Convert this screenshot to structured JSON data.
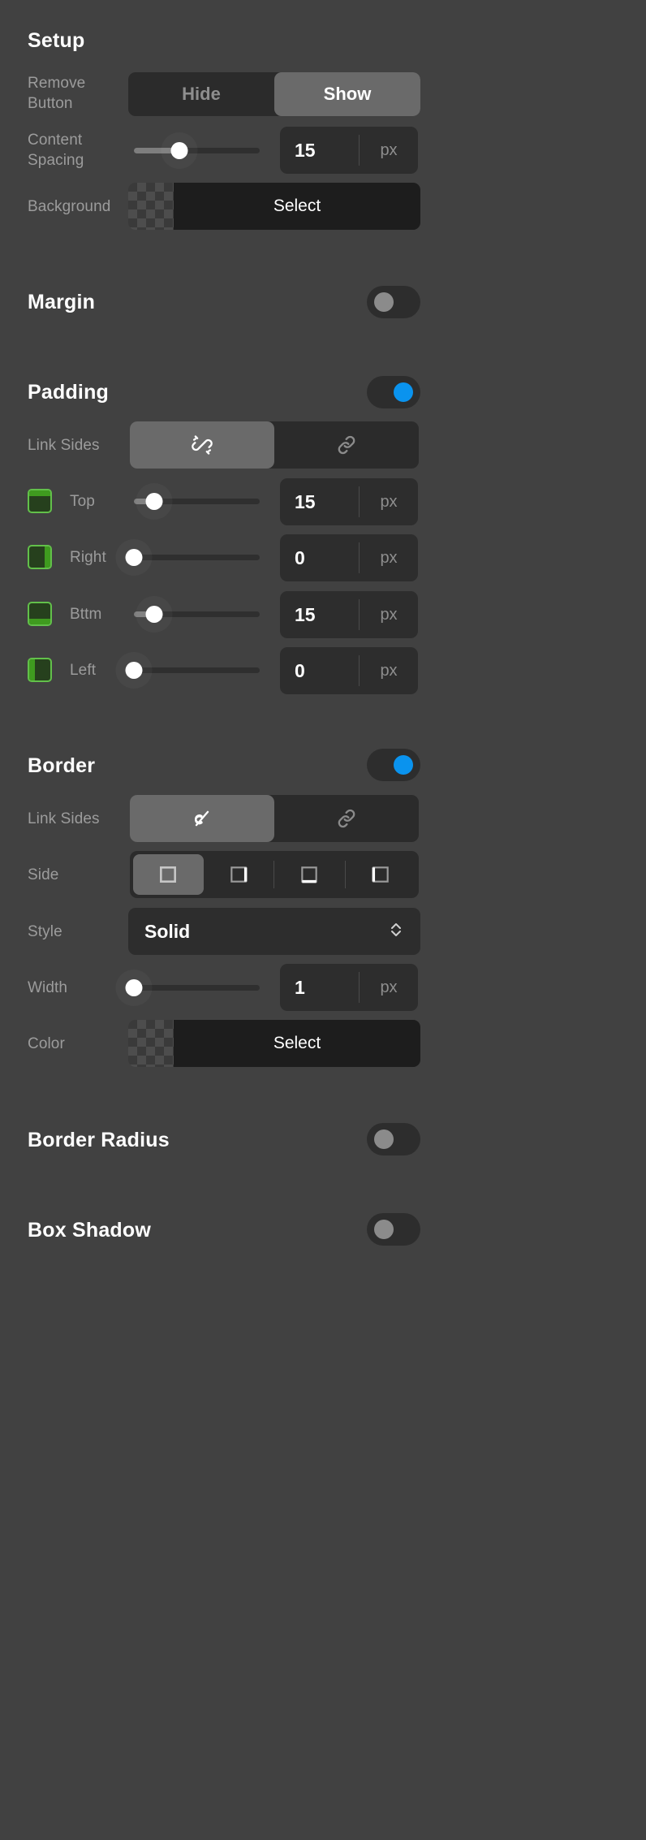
{
  "setup": {
    "title": "Setup",
    "remove_button": {
      "label": "Remove Button",
      "label_line1": "Remove",
      "label_line2": "Button",
      "options": [
        "Hide",
        "Show"
      ],
      "selected": "Show"
    },
    "content_spacing": {
      "label": "Content Spacing",
      "label_line1": "Content",
      "label_line2": "Spacing",
      "value": "15",
      "unit": "px",
      "slider_percent": 36
    },
    "background": {
      "label": "Background",
      "button_label": "Select"
    }
  },
  "margin": {
    "title": "Margin",
    "enabled": false
  },
  "padding": {
    "title": "Padding",
    "enabled": true,
    "link_sides": {
      "label": "Link Sides",
      "options": [
        "unlink-icon",
        "link-icon"
      ],
      "selected": "unlink-icon"
    },
    "sides": [
      {
        "label": "Top",
        "icon": "side-top-icon",
        "value": "15",
        "unit": "px",
        "slider_percent": 16
      },
      {
        "label": "Right",
        "icon": "side-right-icon",
        "value": "0",
        "unit": "px",
        "slider_percent": 2
      },
      {
        "label": "Bttm",
        "icon": "side-bottom-icon",
        "value": "15",
        "unit": "px",
        "slider_percent": 16
      },
      {
        "label": "Left",
        "icon": "side-left-icon",
        "value": "0",
        "unit": "px",
        "slider_percent": 2
      }
    ]
  },
  "border": {
    "title": "Border",
    "enabled": true,
    "link_sides": {
      "label": "Link Sides",
      "options": [
        "unlink-icon",
        "link-icon"
      ],
      "selected": "unlink-icon"
    },
    "side": {
      "label": "Side",
      "options": [
        "border-all-icon",
        "border-right-icon",
        "border-bottom-icon",
        "border-left-icon"
      ],
      "selected_index": 0
    },
    "style": {
      "label": "Style",
      "value": "Solid"
    },
    "width": {
      "label": "Width",
      "value": "1",
      "unit": "px",
      "slider_percent": 2
    },
    "color": {
      "label": "Color",
      "button_label": "Select"
    }
  },
  "border_radius": {
    "title": "Border Radius",
    "enabled": false
  },
  "box_shadow": {
    "title": "Box Shadow",
    "enabled": false
  },
  "colors": {
    "panel_bg": "#414141",
    "field_bg": "#2d2d2d",
    "active_seg": "#6a6a6a",
    "accent_on": "#0a93ee",
    "accent_off": "#8b8b8b",
    "side_icon_border": "#62c04a",
    "side_icon_fill": "#3f9b1f",
    "label_text": "#9c9c9c",
    "value_text": "#ffffff"
  }
}
